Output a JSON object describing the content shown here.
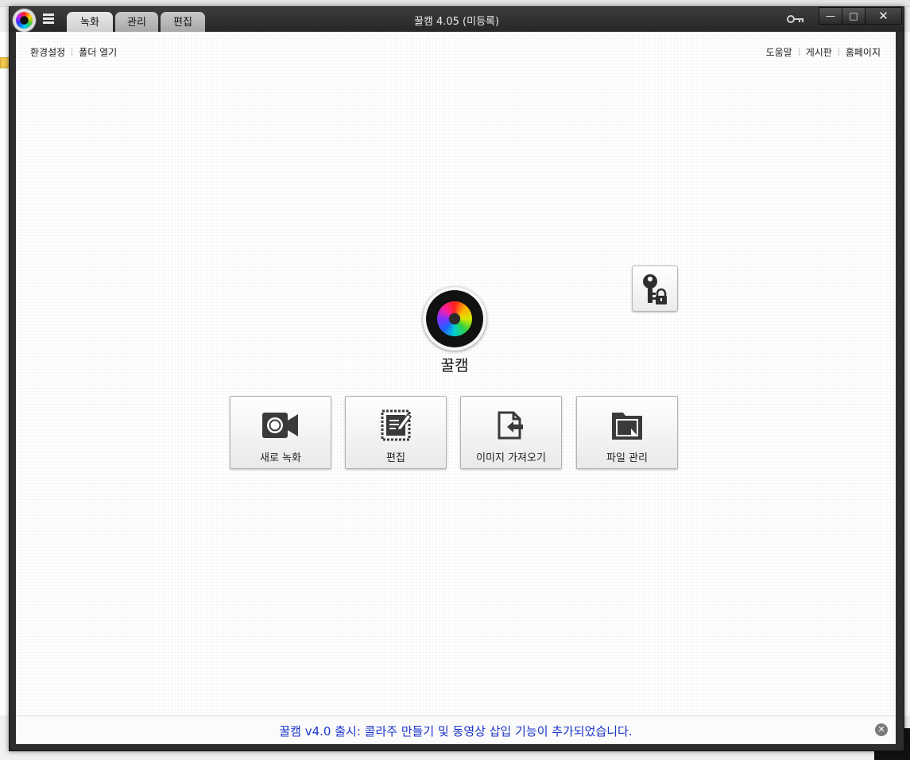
{
  "window": {
    "title": "꿀캠 4.05 (미등록)",
    "tabs": [
      {
        "label": "녹화"
      },
      {
        "label": "관리"
      },
      {
        "label": "편집"
      }
    ],
    "controls": {
      "minimize": "—",
      "maximize": "□",
      "close": "✕"
    }
  },
  "toplinks": {
    "left": [
      "환경설정",
      "폴더 열기"
    ],
    "right": [
      "도움말",
      "게시판",
      "홈페이지"
    ]
  },
  "center": {
    "app_name": "꿀캠"
  },
  "actions": [
    {
      "label": "새로 녹화",
      "icon": "video-camera-icon"
    },
    {
      "label": "편집",
      "icon": "edit-icon"
    },
    {
      "label": "이미지 가져오기",
      "icon": "import-image-icon"
    },
    {
      "label": "파일 관리",
      "icon": "folder-icon"
    }
  ],
  "notice": {
    "text": "꿀캠 v4.0 출시: 콜라주 만들기 및 동영상 삽입 기능이 추가되었습니다.",
    "close": "✕"
  },
  "colors": {
    "notice_text": "#1a33cc",
    "titlebar": "#2d2d2d"
  }
}
